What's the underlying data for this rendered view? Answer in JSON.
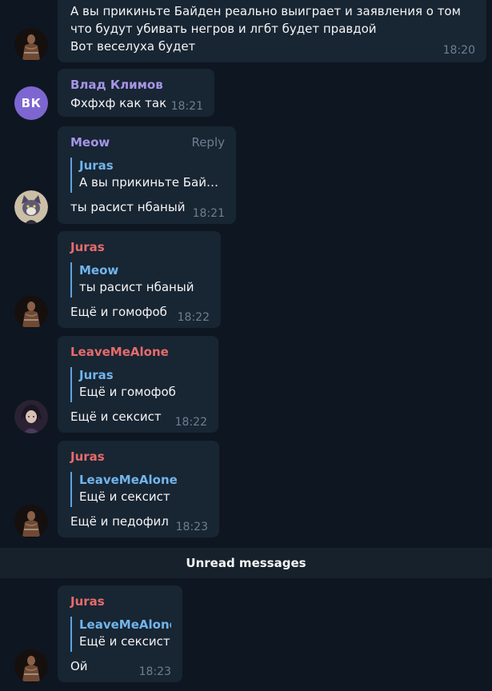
{
  "colors": {
    "background": "#0e1621",
    "bubble": "#182533",
    "name_purple": "#a695e7",
    "name_red": "#e76b6b",
    "quote_accent": "#71b5ec",
    "time": "#6d7f8f"
  },
  "messages": [
    {
      "sender": "",
      "avatar_icon": "juras-avatar",
      "lines": [
        "А вы прикиньте Байден реально выиграет и заявления о том",
        "что будут убивать негров и лгбт будет правдой",
        "Вот веселуха будет"
      ],
      "time": "18:20"
    },
    {
      "sender": "Влад Климов",
      "avatar_initials": "ВК",
      "text": "Фхфхф как так",
      "time": "18:21"
    },
    {
      "sender": "Meow",
      "avatar_icon": "cat-avatar",
      "reply_label": "Reply",
      "quote": {
        "name": "Juras",
        "text": "А вы прикиньте Байден реально выиграет"
      },
      "text": "ты расист нбаный",
      "time": "18:21"
    },
    {
      "sender": "Juras",
      "avatar_icon": "juras-avatar",
      "quote": {
        "name": "Meow",
        "text": "ты расист нбаный"
      },
      "text": "Ещё и гомофоб",
      "time": "18:22"
    },
    {
      "sender": "LeaveMeAlone",
      "avatar_icon": "anime-avatar",
      "quote": {
        "name": "Juras",
        "text": "Ещё и гомофоб"
      },
      "text": "Ещё и сексист",
      "time": "18:22"
    },
    {
      "sender": "Juras",
      "avatar_icon": "juras-avatar",
      "quote": {
        "name": "LeaveMeAlone",
        "text": "Ещё и сексист"
      },
      "text": "Ещё и педофил",
      "time": "18:23"
    },
    {
      "sender": "Juras",
      "avatar_icon": "juras-avatar",
      "quote": {
        "name": "LeaveMeAlone",
        "text": "Ещё и сексист"
      },
      "text": "Ой",
      "time": "18:23"
    }
  ],
  "unread_divider": "Unread messages"
}
